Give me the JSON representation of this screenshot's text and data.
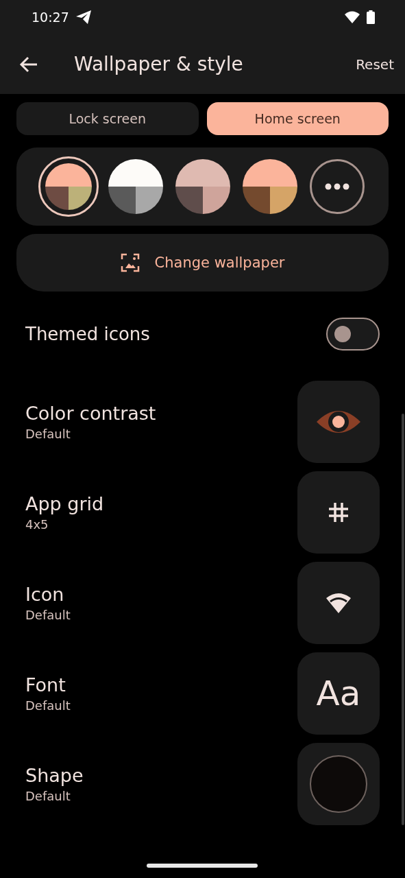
{
  "status_bar": {
    "time": "10:27"
  },
  "app_bar": {
    "title": "Wallpaper & style",
    "action": "Reset"
  },
  "tabs": [
    {
      "label": "Lock screen",
      "selected": false
    },
    {
      "label": "Home screen",
      "selected": true
    }
  ],
  "palettes": [
    {
      "selected": true,
      "segments": [
        {
          "color": "#fbb49b"
        },
        {
          "color": "#6e4c43"
        },
        {
          "color": "#bcb179"
        }
      ]
    },
    {
      "selected": false,
      "segments": [
        {
          "color": "#fdfbf8"
        },
        {
          "color": "#5a5a5a"
        },
        {
          "color": "#a8a8a8"
        }
      ]
    },
    {
      "selected": false,
      "segments": [
        {
          "color": "#dfbab1"
        },
        {
          "color": "#5f4d4b"
        },
        {
          "color": "#cfa49b"
        }
      ]
    },
    {
      "selected": false,
      "segments": [
        {
          "color": "#fbb49b"
        },
        {
          "color": "#744a2e"
        },
        {
          "color": "#d5a467"
        }
      ]
    }
  ],
  "change_wallpaper": {
    "label": "Change wallpaper"
  },
  "themed_icons": {
    "label": "Themed icons",
    "on": false
  },
  "options": [
    {
      "title": "Color contrast",
      "subtitle": "Default",
      "kind": "eye"
    },
    {
      "title": "App grid",
      "subtitle": "4x5",
      "kind": "grid"
    },
    {
      "title": "Icon",
      "subtitle": "Default",
      "kind": "wifi"
    },
    {
      "title": "Font",
      "subtitle": "Default",
      "kind": "font",
      "preview_text": "Aa"
    },
    {
      "title": "Shape",
      "subtitle": "Default",
      "kind": "shape"
    }
  ]
}
